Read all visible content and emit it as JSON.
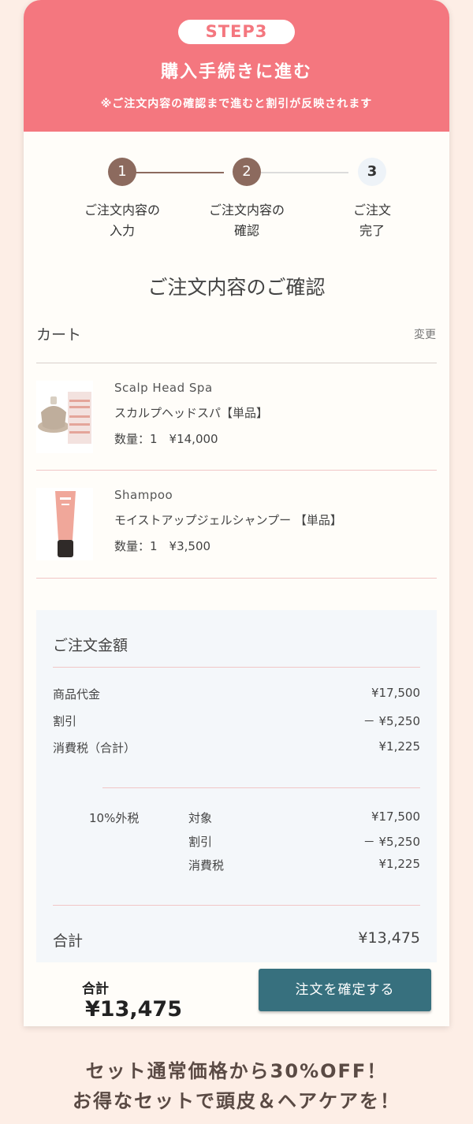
{
  "header": {
    "step_badge": "STEP3",
    "title": "購入手続きに進む",
    "note": "※ご注文内容の確認まで進むと割引が反映されます"
  },
  "steps": [
    {
      "number": "1",
      "label_line1": "ご注文内容の",
      "label_line2": "入力"
    },
    {
      "number": "2",
      "label_line1": "ご注文内容の",
      "label_line2": "確認"
    },
    {
      "number": "3",
      "label_line1": "ご注文",
      "label_line2": "完了"
    }
  ],
  "colors": {
    "accent_pink": "#f4777f",
    "step_done": "#8c6a5e",
    "button": "#37707e"
  },
  "page_title": "ご注文内容のご確認",
  "cart": {
    "label": "カート",
    "change_link": "変更",
    "items": [
      {
        "name_en": "Scalp Head Spa",
        "name_jp": "スカルプヘッドスパ【単品】",
        "qty_price": "数量：1　¥14,000"
      },
      {
        "name_en": "Shampoo",
        "name_jp": "モイストアップジェルシャンプー 【単品】",
        "qty_price": "数量：1　¥3,500"
      }
    ]
  },
  "summary": {
    "title": "ご注文金額",
    "rows": [
      {
        "label": "商品代金",
        "value": "¥17,500"
      },
      {
        "label": "割引",
        "value": "－ ¥5,250"
      },
      {
        "label": "消費税（合計）",
        "value": "¥1,225"
      }
    ],
    "tax_label": "10%外税",
    "tax_rows": [
      {
        "label": "対象",
        "value": "¥17,500"
      },
      {
        "label": "割引",
        "value": "－ ¥5,250"
      },
      {
        "label": "消費税",
        "value": "¥1,225"
      }
    ],
    "total_label": "合計",
    "total_value": "¥13,475"
  },
  "footer": {
    "total_label": "合計",
    "total_value": "¥13,475",
    "confirm_button": "注文を確定する"
  },
  "promo": {
    "line1": "セット通常価格から30%OFF！",
    "line2": "お得なセットで頭皮＆ヘアケアを！"
  }
}
